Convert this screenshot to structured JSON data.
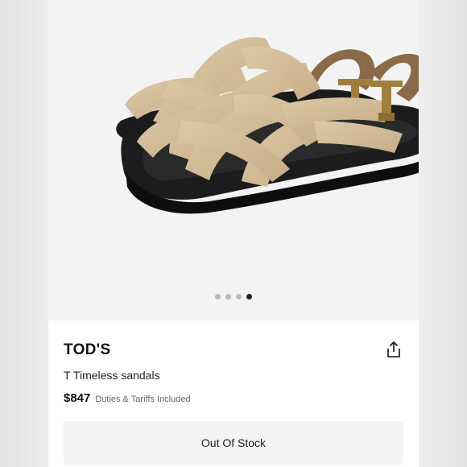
{
  "gallery": {
    "image_alt": "T Timeless sandals product photo",
    "page_count": 4,
    "active_index": 3
  },
  "product": {
    "brand": "TOD'S",
    "name": "T Timeless sandals",
    "price": "$847",
    "duties_note": "Duties & Tariffs Included"
  },
  "actions": {
    "share_icon": "share-icon",
    "stock_button_label": "Out Of Stock"
  },
  "colors": {
    "suede": "#d2bc98",
    "sole": "#1b1b1b",
    "buckle": "#a07f3e",
    "strap_tan": "#8a6a48"
  }
}
